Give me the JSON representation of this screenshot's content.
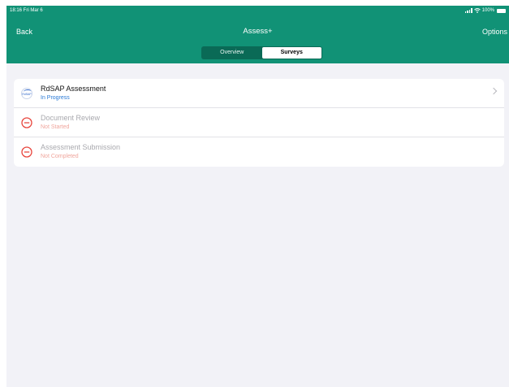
{
  "status_bar": {
    "time_date": "18:16 Fri Mar 6",
    "battery": "100%"
  },
  "nav": {
    "back_label": "Back",
    "title": "Assess+",
    "options_label": "Options"
  },
  "segments": [
    {
      "label": "Overview",
      "active": false
    },
    {
      "label": "Surveys",
      "active": true
    }
  ],
  "list": [
    {
      "title": "RdSAP Assessment",
      "subtitle": "In Progress",
      "icon": "rdsap-logo-icon",
      "logo_text": "RdSAP",
      "subtitle_color": "#2a7ad6"
    },
    {
      "title": "Document Review",
      "subtitle": "Not Started",
      "icon": "minus-circle-icon",
      "subtitle_color": "#f0a59c"
    },
    {
      "title": "Assessment Submission",
      "subtitle": "Not Completed",
      "icon": "minus-circle-icon",
      "subtitle_color": "#f0a59c"
    }
  ],
  "colors": {
    "header": "#119276",
    "accent_blue": "#2a7ad6",
    "error_red": "#e8453c"
  }
}
